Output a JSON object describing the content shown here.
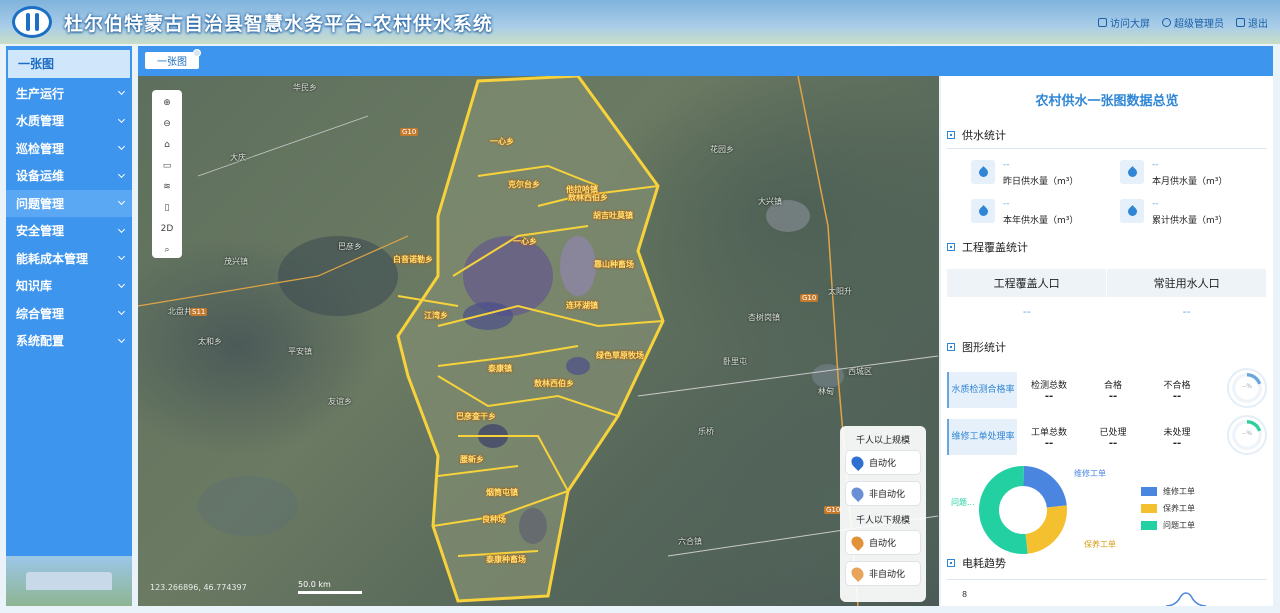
{
  "app": {
    "title": "杜尔伯特蒙古自治县智慧水务平台-农村供水系统",
    "header_links": [
      {
        "label": "访问大屏",
        "icon": "screen-icon"
      },
      {
        "label": "超级管理员",
        "icon": "user-icon"
      },
      {
        "label": "退出",
        "icon": "logout-icon"
      }
    ]
  },
  "sidebar": {
    "items": [
      {
        "label": "一张图",
        "expandable": false,
        "active": true
      },
      {
        "label": "生产运行",
        "expandable": true
      },
      {
        "label": "水质管理",
        "expandable": true
      },
      {
        "label": "巡检管理",
        "expandable": true
      },
      {
        "label": "设备运维",
        "expandable": true
      },
      {
        "label": "问题管理",
        "expandable": true,
        "hover": true
      },
      {
        "label": "安全管理",
        "expandable": true
      },
      {
        "label": "能耗成本管理",
        "expandable": true
      },
      {
        "label": "知识库",
        "expandable": true
      },
      {
        "label": "综合管理",
        "expandable": true
      },
      {
        "label": "系统配置",
        "expandable": true
      }
    ]
  },
  "tabs": [
    {
      "label": "一张图"
    }
  ],
  "map": {
    "toolbar": [
      {
        "icon": "zoom-in-icon",
        "glyph": "⊕"
      },
      {
        "icon": "zoom-out-icon",
        "glyph": "⊖"
      },
      {
        "icon": "home-icon",
        "glyph": "⌂"
      },
      {
        "icon": "layers-icon",
        "glyph": "▭"
      },
      {
        "icon": "measure-icon",
        "glyph": "≋"
      },
      {
        "icon": "print-icon",
        "glyph": "▯"
      },
      {
        "icon": "mode-2d-icon",
        "glyph": "2D"
      },
      {
        "icon": "search-icon",
        "glyph": "⌕"
      }
    ],
    "coordinates": "123.266896, 46.774397",
    "scale": "50.0 km",
    "place_labels": [
      "华民乡",
      "大庆",
      "茂兴镇",
      "巴彦乡",
      "北盘井",
      "太和乡",
      "平安镇",
      "友谊乡",
      "花园乡",
      "大兴镇",
      "太阳升",
      "杏树岗镇",
      "卧里屯",
      "乐桥",
      "林甸",
      "西城区",
      "六合镇"
    ],
    "region_labels": [
      "一心乡",
      "克尔台乡",
      "敖林西伯乡",
      "胡吉吐莫镇",
      "他拉哈镇",
      "江湾乡",
      "白音诺勒乡",
      "一心乡",
      "连环湖镇",
      "泰康镇",
      "巴彦查干乡",
      "腰新乡",
      "烟筒屯镇",
      "良种场",
      "泰康种畜场",
      "靠山种畜场",
      "绿色草原牧场",
      "敖林西伯乡"
    ],
    "road_badges": [
      "G10",
      "G10",
      "S11",
      "G10"
    ],
    "legend": {
      "group1_title": "千人以上规模",
      "group1_items": [
        "自动化",
        "非自动化"
      ],
      "group2_title": "千人以下规模",
      "group2_items": [
        "自动化",
        "非自动化"
      ],
      "colors": {
        "auto_above": "#2f6fd0",
        "manual_above": "#6b8fd6",
        "auto_below": "#e0913a",
        "manual_below": "#e7a45a"
      }
    }
  },
  "panel": {
    "title": "农村供水一张图数据总览",
    "supply": {
      "title": "供水统计",
      "stats": [
        {
          "value": "--",
          "label": "昨日供水量（m³）"
        },
        {
          "value": "--",
          "label": "本月供水量（m³）"
        },
        {
          "value": "--",
          "label": "本年供水量（m³）"
        },
        {
          "value": "--",
          "label": "累计供水量（m³）"
        }
      ]
    },
    "coverage": {
      "title": "工程覆盖统计",
      "headers": [
        "工程覆盖人口",
        "常驻用水人口"
      ],
      "values": [
        "--",
        "--"
      ]
    },
    "graphics": {
      "title": "图形统计",
      "cards": [
        {
          "name": "水质检测合格率",
          "cols": [
            {
              "label": "检测总数",
              "value": "--"
            },
            {
              "label": "合格",
              "value": "--"
            },
            {
              "label": "不合格",
              "value": "--"
            }
          ],
          "gauge": "--%",
          "gauge_fraction": 0.2,
          "color": "#6aa6de"
        },
        {
          "name": "维修工单处理率",
          "cols": [
            {
              "label": "工单总数",
              "value": "--"
            },
            {
              "label": "已处理",
              "value": "--"
            },
            {
              "label": "未处理",
              "value": "--"
            }
          ],
          "gauge": "--%",
          "gauge_fraction": 0.2,
          "color": "#2fcf9a"
        }
      ],
      "donut": {
        "labels": {
          "repair": "维修工单",
          "maintain": "保养工单",
          "problem": "问题..."
        },
        "segments": [
          {
            "name": "维修工单",
            "fraction": 0.23,
            "color": "#4a86e0"
          },
          {
            "name": "保养工单",
            "fraction": 0.25,
            "color": "#f4c030"
          },
          {
            "name": "问题工单",
            "fraction": 0.52,
            "color": "#22d0a2"
          }
        ]
      }
    },
    "energy": {
      "title": "电耗趋势",
      "y_tick": "8"
    }
  }
}
